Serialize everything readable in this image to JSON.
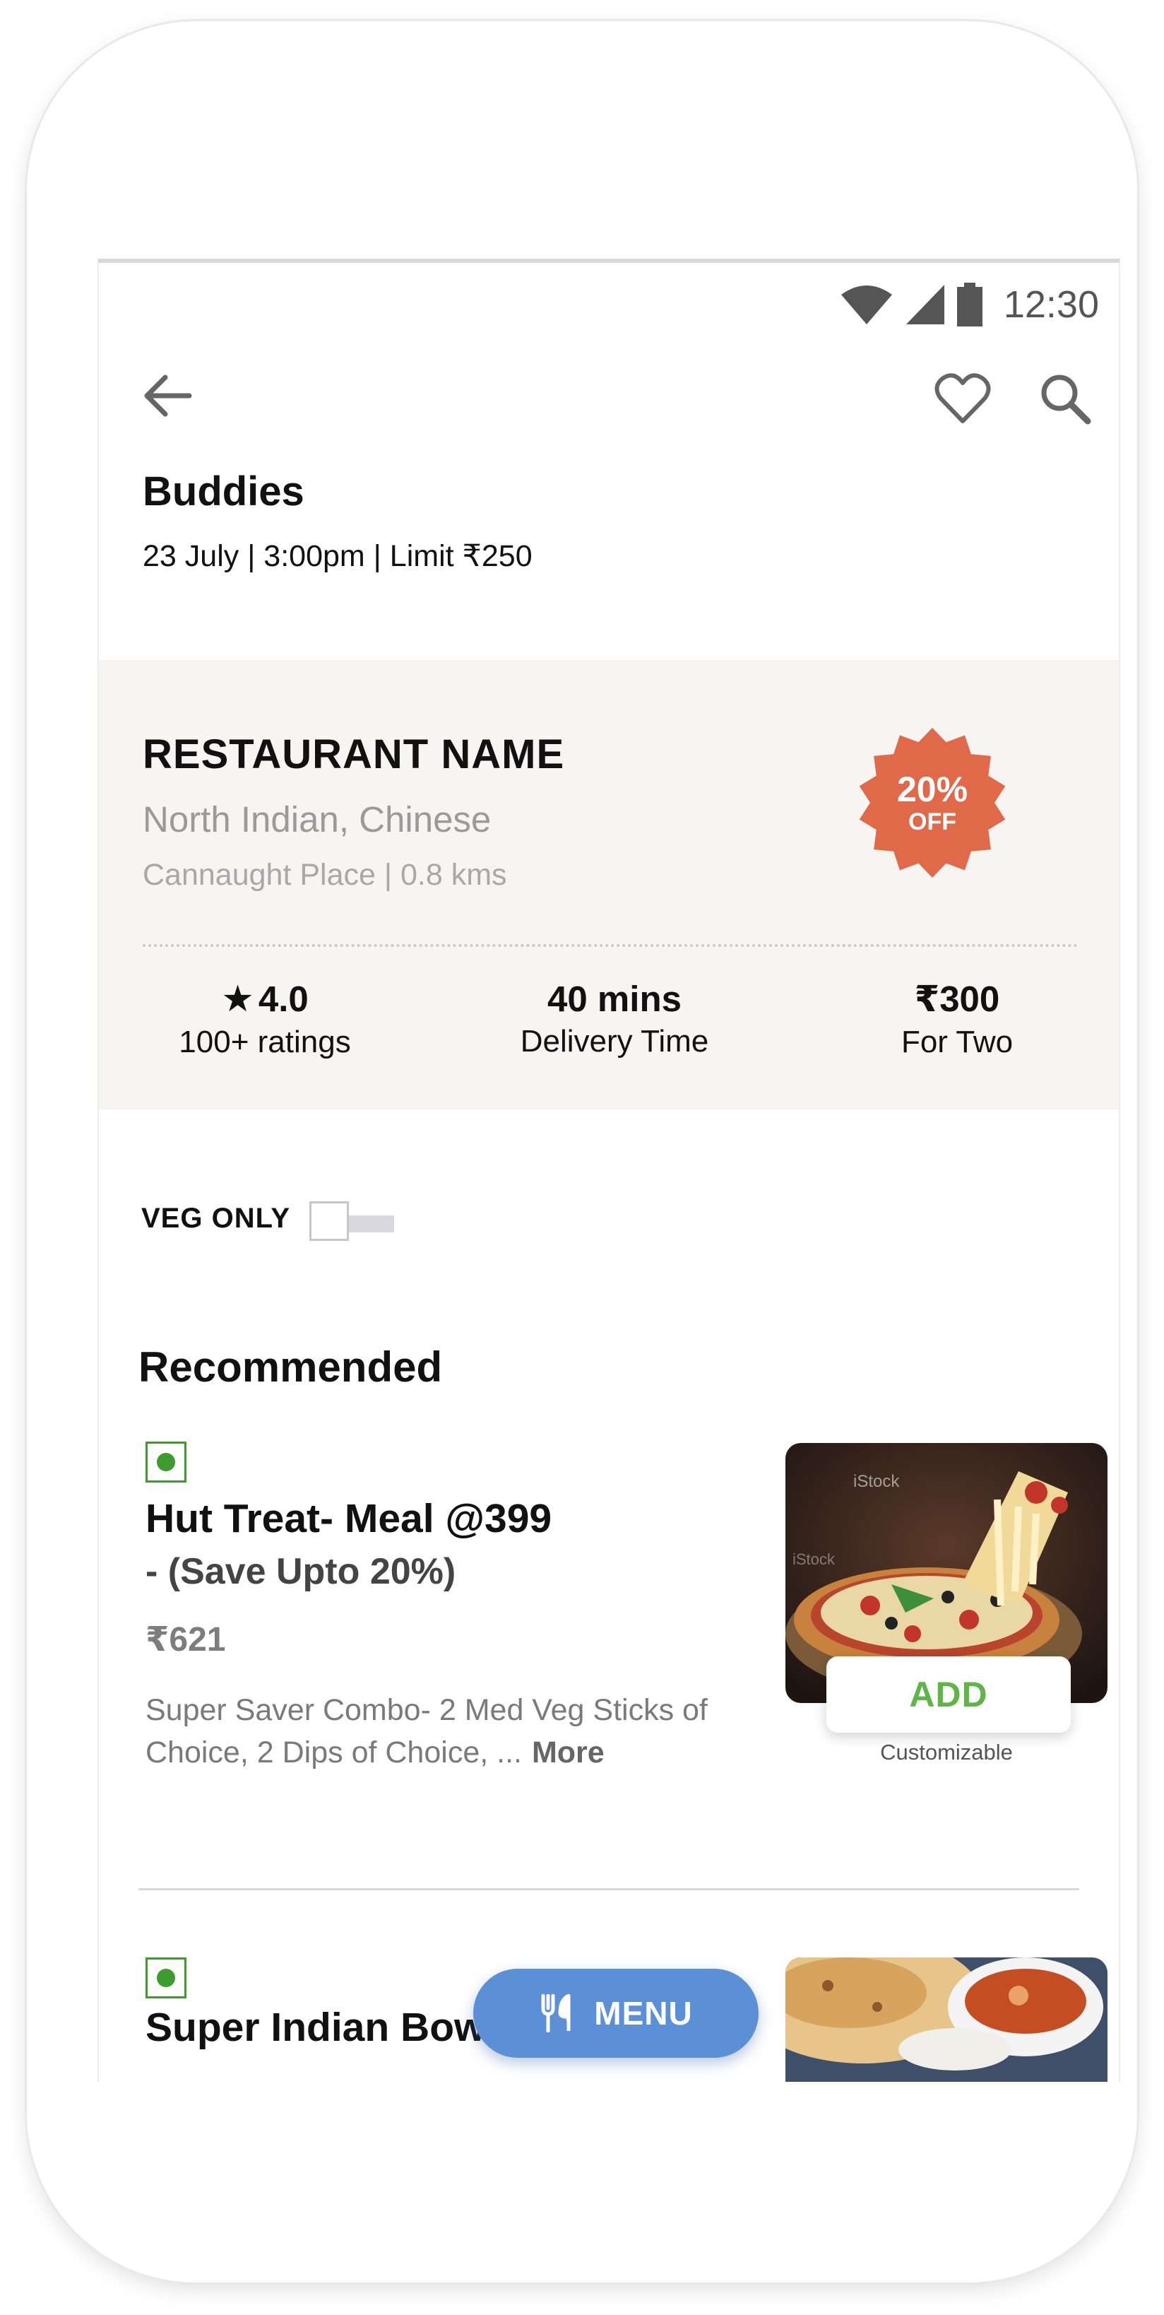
{
  "status_bar": {
    "time": "12:30"
  },
  "group": {
    "title": "Buddies",
    "meta": "23 July | 3:00pm | Limit ₹250"
  },
  "restaurant": {
    "name": "RESTAURANT NAME",
    "cuisine": "North Indian, Chinese",
    "location": "Cannaught Place | 0.8 kms",
    "offer": {
      "percent": "20%",
      "label": "OFF",
      "color": "#e0694a"
    },
    "stats": {
      "rating_value": "4.0",
      "rating_label": "100+ ratings",
      "delivery_value": "40 mins",
      "delivery_label": "Delivery Time",
      "cost_value": "₹300",
      "cost_label": "For Two"
    }
  },
  "filters": {
    "veg_only_label": "VEG ONLY",
    "veg_only_on": false
  },
  "section": {
    "title": "Recommended"
  },
  "items": [
    {
      "title": "Hut Treat- Meal @399",
      "subtitle": "- (Save Upto 20%)",
      "price": "₹621",
      "description": "Super Saver Combo- 2 Med Veg Sticks of Choice, 2 Dips of Choice, ...",
      "more_label": "More",
      "add_label": "ADD",
      "customizable_label": "Customizable",
      "image_icon": "pizza-image"
    },
    {
      "title": "Super Indian Bowl",
      "image_icon": "indian-bowl-image"
    }
  ],
  "fab": {
    "label": "MENU",
    "icon": "cutlery-icon",
    "color": "#5b8fd6"
  },
  "colors": {
    "veg_green": "#3d9c2d",
    "add_green": "#5fb548",
    "card_bg": "#f7f5f2"
  }
}
